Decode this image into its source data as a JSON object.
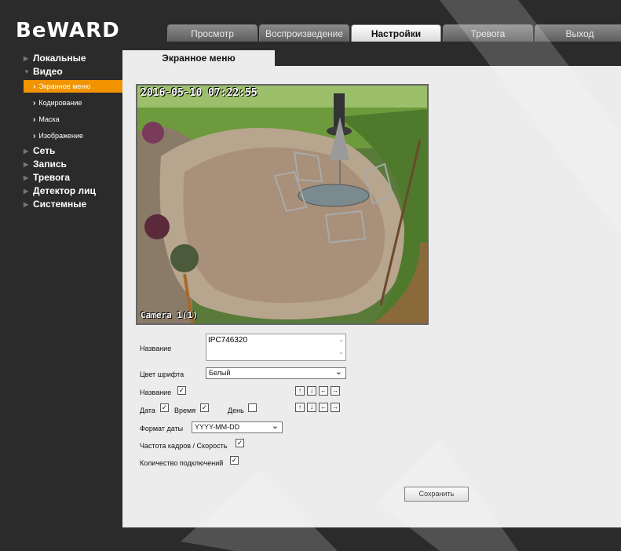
{
  "brand": {
    "logo_text": "BeWARD"
  },
  "topnav": [
    {
      "label": "Просмотр",
      "active": false
    },
    {
      "label": "Воспроизведение",
      "active": false
    },
    {
      "label": "Настройки",
      "active": true
    },
    {
      "label": "Тревога",
      "active": false
    },
    {
      "label": "Выход",
      "active": false
    }
  ],
  "sidebar": {
    "local": "Локальные",
    "video": "Видео",
    "video_sub": [
      "Экранное меню",
      "Кодирование",
      "Маска",
      "Изображение"
    ],
    "network": "Сеть",
    "record": "Запись",
    "alarm": "Тревога",
    "face": "Детектор лиц",
    "system": "Системные"
  },
  "subtab": {
    "label": "Экранное меню"
  },
  "video": {
    "osd_time": "2016-05-10 07:22:55",
    "osd_name": "Camera 1(1)"
  },
  "form": {
    "name_label": "Название",
    "name_value": "IPC746320",
    "font_color_label": "Цвет шрифта",
    "font_color_value": "Белый",
    "show_name_label": "Название",
    "date_label": "Дата",
    "time_label": "Время",
    "day_label": "День",
    "date_format_label": "Формат даты",
    "date_format_value": "YYYY-MM-DD",
    "fps_label": "Частота кадров / Скорость",
    "connections_label": "Количество подключений",
    "save_label": "Сохранить",
    "checks": {
      "name": true,
      "date": true,
      "time": true,
      "day": false,
      "fps": true,
      "connections": true
    },
    "check_mark": "✓",
    "arrow_up": "↑",
    "arrow_down": "↓",
    "arrow_left": "←",
    "arrow_right": "→"
  },
  "colors": {
    "accent": "#f29400",
    "panel": "#ececec",
    "background": "#2b2b2b"
  }
}
